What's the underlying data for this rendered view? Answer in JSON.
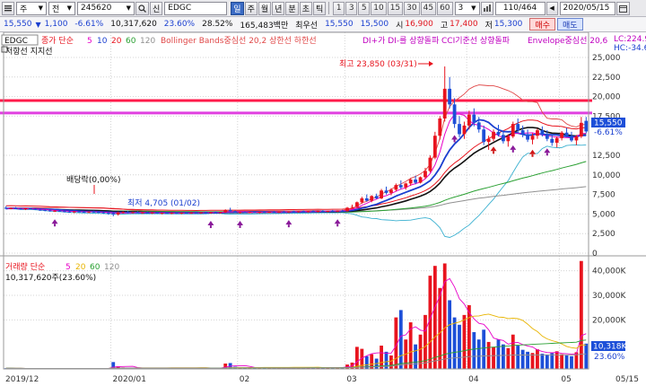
{
  "toolbar": {
    "market_combo": "주",
    "period_combo": "전",
    "code": "245620",
    "new_label": "신",
    "stock_name": "EDGC",
    "period_buttons": [
      "일",
      "주",
      "월",
      "년",
      "분",
      "초",
      "틱"
    ],
    "interval_buttons": [
      "1",
      "3",
      "5",
      "10",
      "15",
      "30",
      "45",
      "60"
    ],
    "interval_value": "3",
    "count": "110/464",
    "date": "2020/05/15"
  },
  "quote": {
    "price": "15,550",
    "change": "1,100",
    "change_rate": "-6.61%",
    "volume": "10,317,620",
    "turnover_rate": "23.60%",
    "ratio": "28.52%",
    "amount": "165,483백만",
    "priority_label": "최우선",
    "ask": "15,550",
    "bid": "15,500",
    "open_label": "시",
    "open": "16,900",
    "high_label": "고",
    "high": "17,400",
    "low_label": "저",
    "low": "15,300",
    "buy_label": "매수",
    "sell_label": "매도"
  },
  "price_legend": {
    "name": "EDGC",
    "close_label": "종가 단순",
    "ma_periods": [
      "5",
      "10",
      "20",
      "60",
      "120"
    ],
    "bollinger": "Bollinger Bands중심선 20,2 상한선 하한선",
    "di": "DI+가 DI-를 상향돌파",
    "cci": "CCI기준선 상향돌파",
    "envelope": "Envelope중심선 20,6",
    "resist_support": "저항선 지지선"
  },
  "annotations": {
    "high_note": "최고 23,850 (03/31)",
    "dividend": "배당락(0,00%)",
    "low_note": "최저 4,705 (01/02)"
  },
  "right_labels": {
    "lc": "LC:224.9",
    "hc": "HC:-34.6",
    "current_price": "15,550",
    "current_change": "-6.61%",
    "current_volume": "10,318K",
    "current_turnover": "23.60%"
  },
  "volume_legend": {
    "name": "거래량 단순",
    "ma_periods": [
      "5",
      "20",
      "60",
      "120"
    ],
    "value": "10,317,620주(23.60%)"
  },
  "colors": {
    "up": "#e8141e",
    "down": "#1d4fd8",
    "ma5": "#e800c8",
    "ma10": "#1a3fd0",
    "ma20": "#e8141e",
    "ma60": "#2aa032",
    "ma120": "#909090",
    "bb_upper": "#e04848",
    "bb_lower": "#3ab0d0",
    "line_red": "#ff1a4a",
    "line_magenta": "#e040e0"
  },
  "chart_data": {
    "type": "candlestick",
    "x_labels": [
      "2019/12",
      "2020/01",
      "02",
      "03",
      "04",
      "05",
      "05/15"
    ],
    "price_axis": {
      "ticks": [
        "25,000",
        "22,500",
        "20,000",
        "17,500",
        "12,500",
        "10,000",
        "7,500",
        "5,000",
        "2,500",
        "0"
      ],
      "tick_values": [
        25000,
        22500,
        20000,
        17500,
        12500,
        10000,
        7500,
        5000,
        2500,
        0
      ],
      "range": [
        0,
        25000
      ]
    },
    "volume_axis": {
      "ticks": [
        "40,000K",
        "30,000K",
        "20,000K"
      ],
      "tick_values": [
        40000,
        30000,
        20000
      ],
      "range": [
        0,
        45000
      ]
    },
    "horizontal_lines": [
      19500,
      17900
    ],
    "candles": [
      [
        5800,
        6000,
        5600,
        5700
      ],
      [
        5700,
        5850,
        5600,
        5750
      ],
      [
        5750,
        5900,
        5650,
        5680
      ],
      [
        5680,
        5800,
        5550,
        5600
      ],
      [
        5600,
        5750,
        5500,
        5720
      ],
      [
        5720,
        5800,
        5600,
        5650
      ],
      [
        5650,
        5700,
        5500,
        5550
      ],
      [
        5550,
        5650,
        5400,
        5500
      ],
      [
        5500,
        5600,
        5350,
        5450
      ],
      [
        5450,
        5550,
        5300,
        5380
      ],
      [
        5380,
        5500,
        5250,
        5420
      ],
      [
        5420,
        5550,
        5300,
        5350
      ],
      [
        5350,
        5450,
        5200,
        5300
      ],
      [
        5300,
        5420,
        5150,
        5250
      ],
      [
        5250,
        5380,
        5100,
        5330
      ],
      [
        5330,
        5450,
        5200,
        5280
      ],
      [
        5280,
        5400,
        5150,
        5220
      ],
      [
        5220,
        5350,
        5100,
        5300
      ],
      [
        5300,
        5420,
        5180,
        5260
      ],
      [
        5260,
        5380,
        5120,
        5200
      ],
      [
        5200,
        5320,
        5050,
        5150
      ],
      [
        5150,
        5280,
        4900,
        5100
      ],
      [
        5100,
        5200,
        4705,
        4950
      ],
      [
        4950,
        5300,
        4800,
        5200
      ],
      [
        5200,
        5350,
        5050,
        5250
      ],
      [
        5250,
        5400,
        5100,
        5180
      ],
      [
        5180,
        5300,
        5050,
        5230
      ],
      [
        5230,
        5350,
        5100,
        5150
      ],
      [
        5150,
        5260,
        5000,
        5200
      ],
      [
        5200,
        5320,
        5080,
        5120
      ],
      [
        5120,
        5250,
        5000,
        5180
      ],
      [
        5180,
        5300,
        5050,
        5100
      ],
      [
        5100,
        5200,
        4950,
        5150
      ],
      [
        5150,
        5280,
        5020,
        5080
      ],
      [
        5080,
        5200,
        4980,
        5140
      ],
      [
        5140,
        5260,
        5030,
        5090
      ],
      [
        5090,
        5200,
        4970,
        5160
      ],
      [
        5160,
        5280,
        5050,
        5110
      ],
      [
        5110,
        5230,
        5000,
        5190
      ],
      [
        5190,
        5320,
        5080,
        5140
      ],
      [
        5140,
        5250,
        5020,
        5200
      ],
      [
        5200,
        5330,
        5090,
        5150
      ],
      [
        5150,
        5270,
        5040,
        5210
      ],
      [
        5210,
        5340,
        5100,
        5160
      ],
      [
        5160,
        5280,
        5050,
        5230
      ],
      [
        5230,
        5600,
        5150,
        5500
      ],
      [
        5500,
        5800,
        5300,
        5350
      ],
      [
        5350,
        5450,
        5100,
        5200
      ],
      [
        5200,
        5300,
        5050,
        5250
      ],
      [
        5250,
        5350,
        5100,
        5180
      ],
      [
        5180,
        5300,
        5080,
        5240
      ],
      [
        5240,
        5350,
        5120,
        5190
      ],
      [
        5190,
        5300,
        5060,
        5260
      ],
      [
        5260,
        5380,
        5140,
        5210
      ],
      [
        5210,
        5320,
        5100,
        5280
      ],
      [
        5280,
        5400,
        5160,
        5230
      ],
      [
        5230,
        5350,
        5120,
        5300
      ],
      [
        5300,
        5420,
        5180,
        5250
      ],
      [
        5250,
        5360,
        5140,
        5320
      ],
      [
        5320,
        5440,
        5200,
        5270
      ],
      [
        5270,
        5380,
        5160,
        5340
      ],
      [
        5340,
        5460,
        5220,
        5290
      ],
      [
        5290,
        5400,
        5180,
        5360
      ],
      [
        5360,
        5480,
        5240,
        5310
      ],
      [
        5310,
        5420,
        5200,
        5380
      ],
      [
        5380,
        5500,
        5260,
        5330
      ],
      [
        5330,
        5450,
        5220,
        5400
      ],
      [
        5400,
        5520,
        5280,
        5350
      ],
      [
        5350,
        5460,
        5240,
        5420
      ],
      [
        5420,
        5540,
        5300,
        5370
      ],
      [
        5370,
        5900,
        5300,
        5800
      ],
      [
        5800,
        6200,
        5700,
        5900
      ],
      [
        5900,
        6600,
        5800,
        6500
      ],
      [
        6500,
        7200,
        6300,
        7000
      ],
      [
        7000,
        7500,
        6600,
        6700
      ],
      [
        6700,
        7400,
        6500,
        7300
      ],
      [
        7300,
        7600,
        6900,
        7000
      ],
      [
        7000,
        8200,
        6900,
        8000
      ],
      [
        8000,
        8500,
        7500,
        7700
      ],
      [
        7700,
        8300,
        7400,
        8100
      ],
      [
        8100,
        8900,
        7900,
        8700
      ],
      [
        8700,
        9300,
        8200,
        8400
      ],
      [
        8400,
        9000,
        8100,
        8900
      ],
      [
        8900,
        9600,
        8600,
        9400
      ],
      [
        9400,
        9900,
        8800,
        9000
      ],
      [
        9000,
        9800,
        8900,
        9700
      ],
      [
        9700,
        10900,
        9500,
        10500
      ],
      [
        10500,
        12500,
        10300,
        12200
      ],
      [
        12200,
        15500,
        12000,
        15000
      ],
      [
        15000,
        17500,
        14500,
        17200
      ],
      [
        17200,
        23850,
        16800,
        21000
      ],
      [
        21000,
        22500,
        18500,
        19000
      ],
      [
        19000,
        19800,
        16000,
        16500
      ],
      [
        16500,
        17500,
        14800,
        15200
      ],
      [
        15200,
        16800,
        14600,
        16300
      ],
      [
        16300,
        18200,
        15800,
        17700
      ],
      [
        17700,
        18500,
        16200,
        16700
      ],
      [
        16700,
        17400,
        15400,
        15800
      ],
      [
        15800,
        16300,
        13800,
        14200
      ],
      [
        14200,
        15000,
        13200,
        14600
      ],
      [
        14600,
        15800,
        14300,
        15500
      ],
      [
        15500,
        16400,
        14900,
        15100
      ],
      [
        15100,
        15600,
        14000,
        14300
      ],
      [
        14300,
        15200,
        13600,
        14900
      ],
      [
        14900,
        16800,
        14700,
        16500
      ],
      [
        16500,
        17200,
        15300,
        15700
      ],
      [
        15700,
        16300,
        14800,
        15200
      ],
      [
        15200,
        15800,
        14200,
        14500
      ],
      [
        14500,
        15300,
        13900,
        15000
      ],
      [
        15000,
        15900,
        14600,
        15700
      ],
      [
        15700,
        16200,
        14900,
        15100
      ],
      [
        15100,
        15700,
        14300,
        14600
      ],
      [
        14600,
        15200,
        13700,
        14100
      ],
      [
        14100,
        14900,
        13500,
        14700
      ],
      [
        14700,
        15600,
        14400,
        15400
      ],
      [
        15400,
        16000,
        14800,
        15000
      ],
      [
        15000,
        15500,
        14200,
        14400
      ],
      [
        14400,
        15100,
        13800,
        14900
      ],
      [
        14900,
        17400,
        14700,
        16650
      ],
      [
        16900,
        17400,
        15300,
        15550
      ]
    ],
    "volume": [
      300,
      250,
      200,
      220,
      180,
      260,
      210,
      190,
      230,
      200,
      240,
      180,
      170,
      200,
      190,
      220,
      210,
      180,
      170,
      200,
      190,
      260,
      2800,
      1100,
      600,
      420,
      380,
      360,
      340,
      320,
      310,
      300,
      290,
      280,
      300,
      320,
      310,
      290,
      300,
      310,
      330,
      320,
      300,
      340,
      360,
      2200,
      2400,
      900,
      700,
      600,
      520,
      480,
      450,
      430,
      420,
      410,
      400,
      420,
      430,
      440,
      460,
      450,
      470,
      480,
      500,
      520,
      510,
      530,
      560,
      600,
      1800,
      2600,
      9000,
      8200,
      5200,
      6000,
      4200,
      9500,
      7000,
      5500,
      21000,
      24000,
      12000,
      19000,
      10000,
      14000,
      22000,
      38000,
      42000,
      33000,
      43000,
      28000,
      21000,
      18000,
      22000,
      26000,
      15000,
      12000,
      16000,
      11000,
      9000,
      12000,
      10000,
      8500,
      14000,
      9500,
      7800,
      7000,
      6500,
      8000,
      6200,
      5800,
      6400,
      7200,
      6000,
      5500,
      5200,
      6800,
      44000,
      10318
    ]
  }
}
